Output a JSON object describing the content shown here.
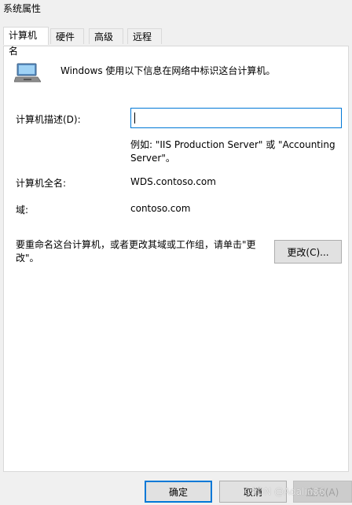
{
  "window": {
    "title": "系统属性"
  },
  "tabs": [
    {
      "label": "计算机名",
      "active": true
    },
    {
      "label": "硬件",
      "active": false
    },
    {
      "label": "高级",
      "active": false
    },
    {
      "label": "远程",
      "active": false
    }
  ],
  "content": {
    "intro_icon": "computer-icon",
    "intro_text": "Windows 使用以下信息在网络中标识这台计算机。",
    "description_label": "计算机描述(D):",
    "description_value": "",
    "description_placeholder": "",
    "example_text": "例如: \"IIS Production Server\" 或 \"Accounting Server\"。",
    "full_name_label": "计算机全名:",
    "full_name_value": "WDS.contoso.com",
    "domain_label": "域:",
    "domain_value": "contoso.com",
    "rename_text": "要重命名这台计算机，或者更改其域或工作组，请单击\"更改\"。",
    "change_button": "更改(C)..."
  },
  "footer": {
    "ok_button": "确定",
    "cancel_button": "取消",
    "apply_button": "应用(A)"
  },
  "watermark": "CSDN @Adalin86",
  "colors": {
    "accent": "#0078d7",
    "background": "#f0f0f0",
    "panel": "#ffffff"
  }
}
